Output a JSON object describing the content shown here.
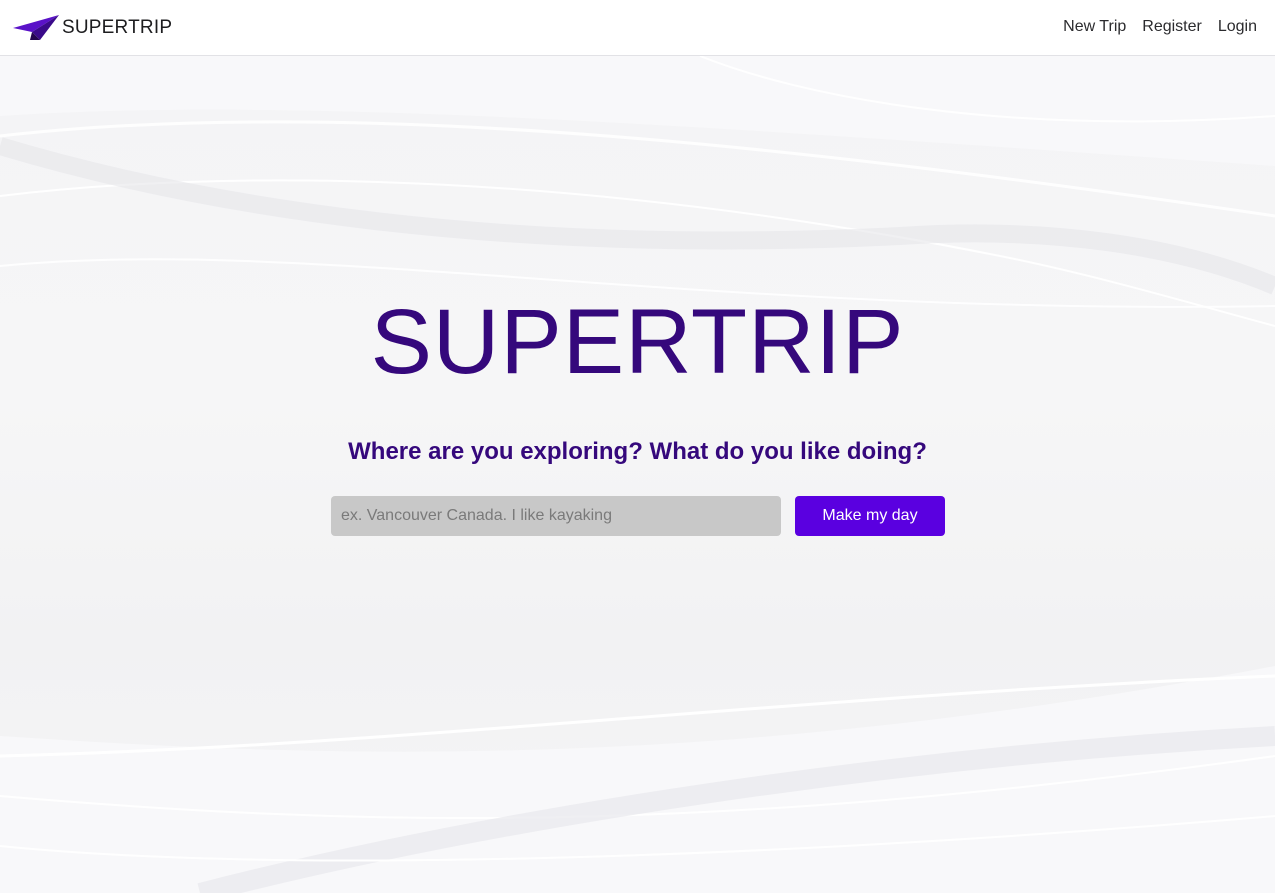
{
  "navbar": {
    "brand_name": "SUPERTRIP",
    "brand_icon": "paper-plane-icon",
    "links": [
      {
        "label": "New Trip"
      },
      {
        "label": "Register"
      },
      {
        "label": "Login"
      }
    ]
  },
  "hero": {
    "title": "SUPERTRIP",
    "subtitle": "Where are you exploring? What do you like doing?",
    "search": {
      "placeholder": "ex. Vancouver Canada. I like kayaking",
      "value": ""
    },
    "submit_label": "Make my day"
  },
  "colors": {
    "brand_purple": "#35087c",
    "button_purple": "#5a00e0",
    "input_gray": "#c8c8c8"
  }
}
